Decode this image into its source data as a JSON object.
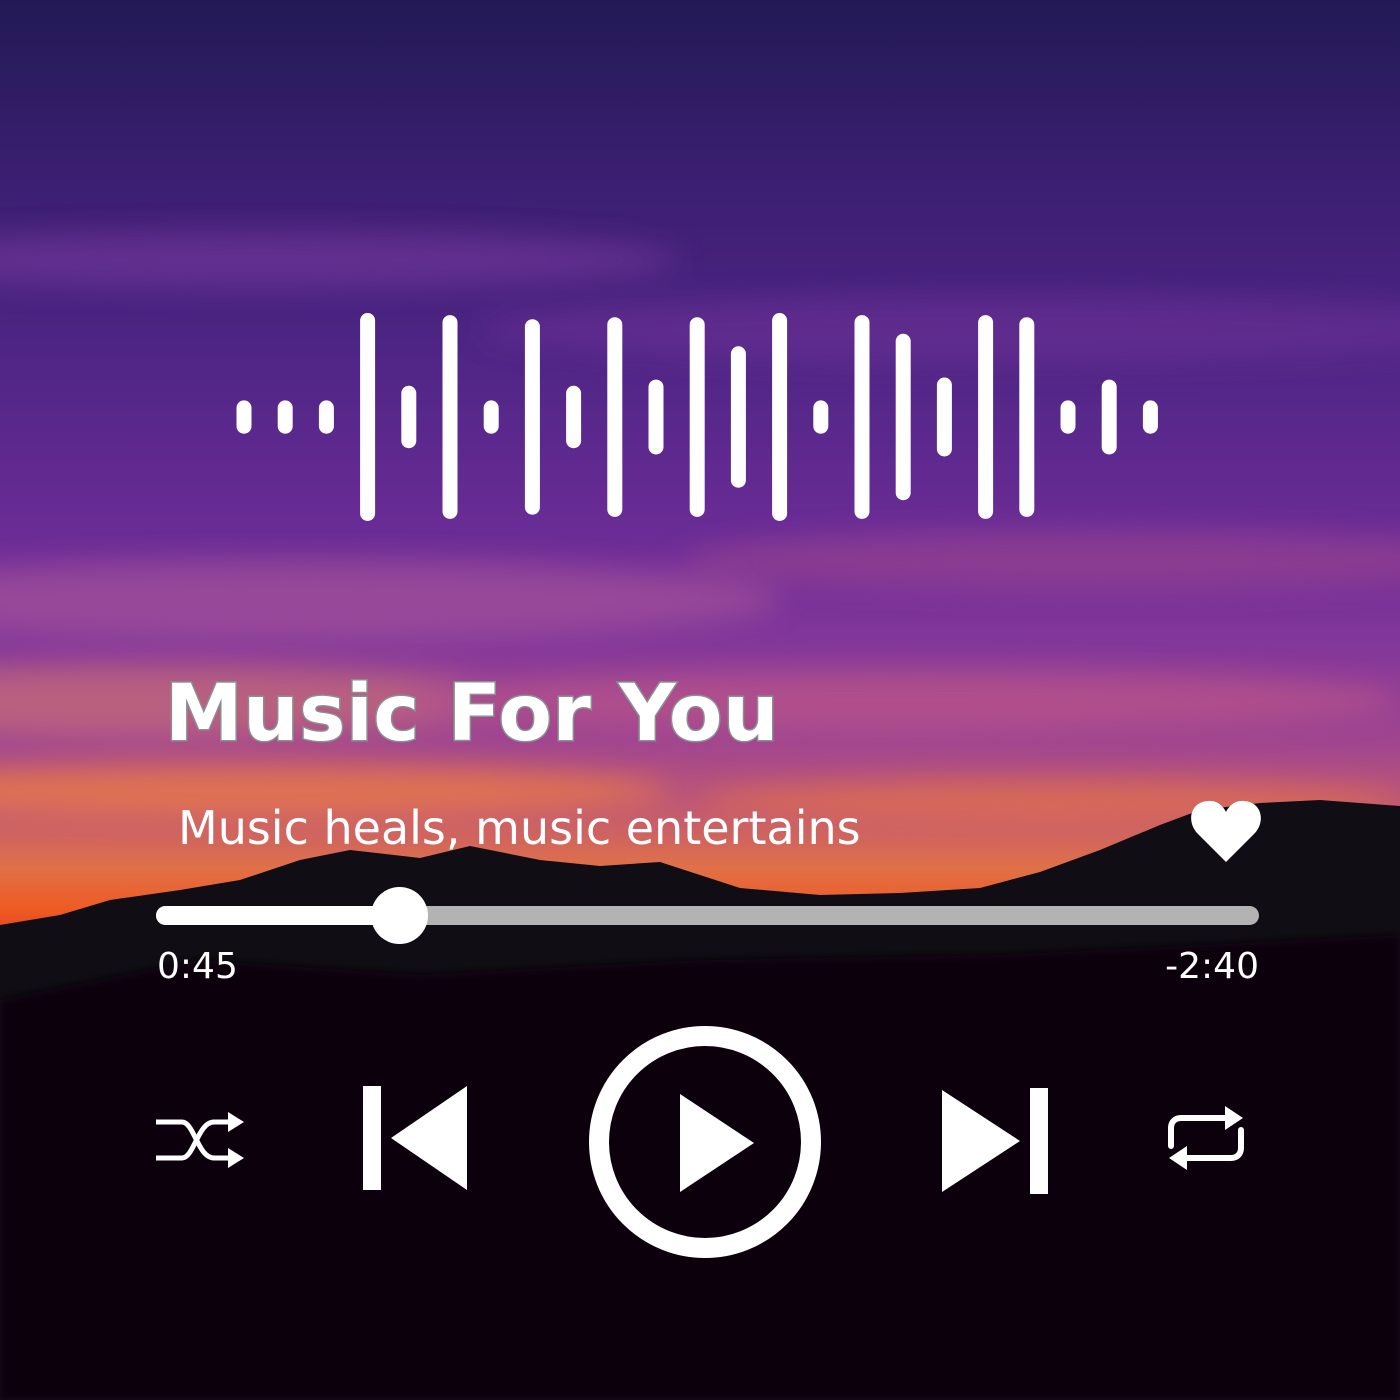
{
  "player": {
    "title": "Music For You",
    "subtitle": "Music heals, music entertains",
    "elapsed": "0:45",
    "remaining": "-2:40",
    "progress_fraction": 0.22,
    "liked": true
  },
  "waveform": {
    "bar_heights": [
      0.16,
      0.16,
      0.16,
      1.0,
      0.3,
      0.98,
      0.16,
      0.94,
      0.3,
      0.96,
      0.36,
      0.96,
      0.68,
      1.0,
      0.16,
      0.98,
      0.8,
      0.38,
      0.98,
      0.96,
      0.16,
      0.36,
      0.16
    ]
  },
  "controls": {
    "shuffle_icon": "shuffle-icon",
    "previous_icon": "skip-previous-icon",
    "play_icon": "play-icon",
    "next_icon": "skip-next-icon",
    "repeat_icon": "repeat-icon",
    "like_icon": "heart-icon"
  },
  "colors": {
    "foreground": "#ffffff",
    "track": "#b3b3b3",
    "title_outline": "#8a8f94"
  }
}
